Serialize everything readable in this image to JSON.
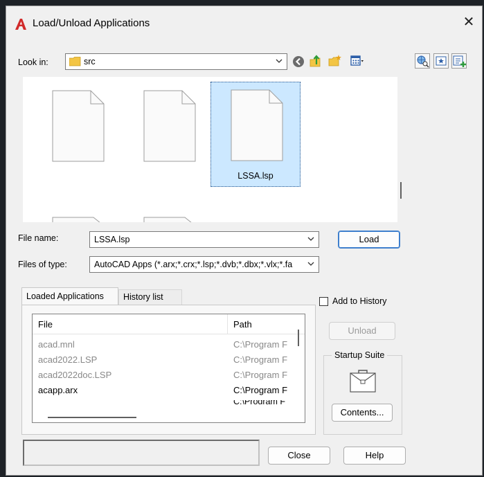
{
  "title": "Load/Unload Applications",
  "look_in": {
    "label": "Look in:",
    "value": "src"
  },
  "files": [
    {
      "name": ""
    },
    {
      "name": ""
    },
    {
      "name": "LSSA.lsp",
      "selected": true
    }
  ],
  "file_name": {
    "label": "File name:",
    "value": "LSSA.lsp"
  },
  "files_of_type": {
    "label": "Files of type:",
    "value": "AutoCAD Apps (*.arx;*.crx;*.lsp;*.dvb;*.dbx;*.vlx;*.fa"
  },
  "load_label": "Load",
  "tabs": [
    {
      "label": "Loaded Applications",
      "active": true
    },
    {
      "label": "History list"
    }
  ],
  "list": {
    "columns": [
      "File",
      "Path"
    ],
    "rows": [
      {
        "file": "acad.mnl",
        "path": "C:\\Program F"
      },
      {
        "file": "acad2022.LSP",
        "path": "C:\\Program F"
      },
      {
        "file": "acad2022doc.LSP",
        "path": "C:\\Program F"
      },
      {
        "file": "acapp.arx",
        "path": "C:\\Program F"
      }
    ]
  },
  "add_to_history": "Add to History",
  "unload_label": "Unload",
  "startup_suite": {
    "title": "Startup Suite",
    "contents_label": "Contents..."
  },
  "close_label": "Close",
  "help_label": "Help",
  "colors": {
    "accent": "#3e7fcd",
    "selection": "#cce8ff",
    "autocad_red": "#d12b2b",
    "folder": "#f3c544"
  }
}
